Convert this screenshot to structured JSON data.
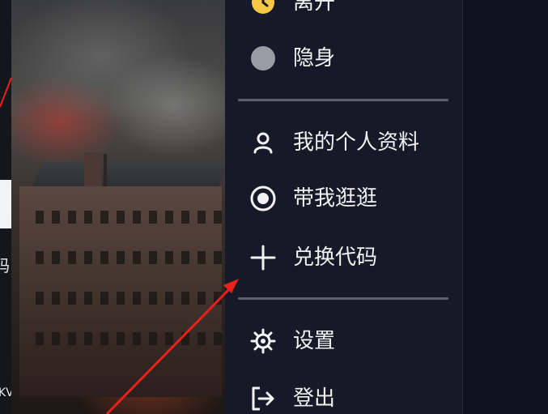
{
  "menu": {
    "items": [
      {
        "label": "离开",
        "icon": "clock-status-icon"
      },
      {
        "label": "隐身",
        "icon": "invisible-status-dot-icon"
      },
      {
        "label": "我的个人资料",
        "icon": "user-icon"
      },
      {
        "label": "带我逛逛",
        "icon": "target-icon"
      },
      {
        "label": "兑换代码",
        "icon": "plus-icon"
      },
      {
        "label": "设置",
        "icon": "gear-icon"
      },
      {
        "label": "登出",
        "icon": "logout-icon"
      }
    ]
  },
  "left_page": {
    "fragments": [
      "码",
      "KV"
    ]
  },
  "colors": {
    "menu_bg": "#161a28",
    "away_status": "#f6c744",
    "invisible_status": "#9a9ba5",
    "divider": "#5b6072",
    "annotation_arrow": "#e8221b"
  }
}
